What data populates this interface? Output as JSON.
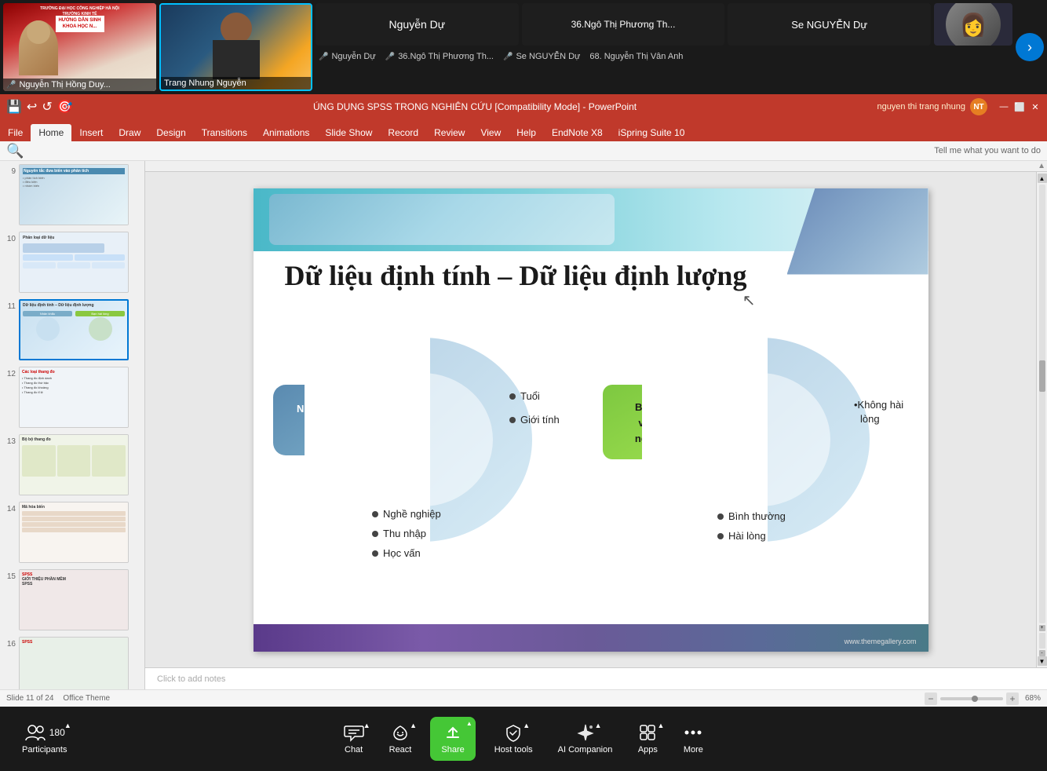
{
  "video_strip": {
    "tiles": [
      {
        "id": 1,
        "name": "Nguyễn Thị Hồng Duy...",
        "bg": "video-bg-1",
        "active": false,
        "mic_muted": true
      },
      {
        "id": 2,
        "name": "Trang Nhung Nguyễn",
        "bg": "video-bg-2",
        "active": true,
        "mic_muted": false
      },
      {
        "id": 3,
        "name": "Nguyễn Dự",
        "bg": "video-bg-3",
        "active": false,
        "mic_muted": true
      },
      {
        "id": 4,
        "name": "36.Ngô Thị Phương Th...",
        "bg": "video-bg-4",
        "active": false,
        "mic_muted": true
      },
      {
        "id": 5,
        "name": "Se NGUYỄN Dự",
        "bg": "video-bg-5",
        "active": false,
        "mic_muted": true
      },
      {
        "id": 6,
        "name": "68. Nguyễn Thị Vân Anh",
        "bg": "video-bg-5",
        "active": false,
        "mic_muted": false
      }
    ]
  },
  "participant_names": [
    {
      "name": "Nguyễn Dự",
      "mic_muted": true
    },
    {
      "name": "36.Ngô Thị Phương Th...",
      "mic_muted": true
    },
    {
      "name": "Se NGUYỄN Dự",
      "mic_muted": true
    },
    {
      "name": "68. Nguyễn Thị Vân Anh",
      "mic_muted": false
    }
  ],
  "ppt_window": {
    "title": "ÚNG DỤNG SPSS TRONG NGHIÊN CỨU [Compatibility Mode] - PowerPoint",
    "user": "nguyen thi trang nhung",
    "user_badge": "NT",
    "quick_tools": [
      "💾",
      "↩",
      "↺",
      "⬇"
    ]
  },
  "ribbon": {
    "tabs": [
      "File",
      "Home",
      "Insert",
      "Draw",
      "Design",
      "Transitions",
      "Animations",
      "Slide Show",
      "Record",
      "Review",
      "View",
      "Help",
      "EndNote X8",
      "iSpring Suite 10"
    ],
    "active_tab": "Home",
    "search_placeholder": "Tell me what you want to do"
  },
  "slide_panel": {
    "slides": [
      9,
      10,
      11,
      12,
      13,
      14,
      15,
      16
    ]
  },
  "current_slide": {
    "number": 11,
    "title": "Dữ liệu định tính – Dữ liệu định lượng",
    "left_diagram": {
      "center_label": "Nhân khẩu/\nkinh tế -\nxã hội",
      "right_labels": [
        "Tuổi",
        "Giới tính"
      ],
      "bottom_labels": [
        "Nghề nghiệp",
        "Thu nhập",
        "Học vấn"
      ]
    },
    "right_diagram": {
      "center_label": "Bạn hài lòng\nvới dịch vụ\nngân hàng A",
      "right_labels": [
        "Không hài\nlòng"
      ],
      "bottom_labels": [
        "Bình thường",
        "Hài lòng"
      ]
    },
    "website": "www.themegallery.com",
    "notes_placeholder": "Click to add notes"
  },
  "zoom_toolbar": {
    "participants_count": "180",
    "items": [
      {
        "label": "Participants",
        "icon": "👥",
        "has_chevron": true
      },
      {
        "label": "Chat",
        "icon": "💬",
        "has_chevron": true
      },
      {
        "label": "React",
        "icon": "♡",
        "has_chevron": true
      },
      {
        "label": "Share",
        "icon": "⬆",
        "has_chevron": true,
        "is_share": true
      },
      {
        "label": "Host tools",
        "icon": "🛡",
        "has_chevron": true
      },
      {
        "label": "AI Companion",
        "icon": "✦",
        "has_chevron": true
      },
      {
        "label": "Apps",
        "icon": "⚙",
        "has_chevron": true
      },
      {
        "label": "More",
        "icon": "•••",
        "has_chevron": true
      }
    ]
  },
  "status_bar": {
    "slide_info": "Slide 11 of 24",
    "theme": "Office Theme",
    "zoom_level": "68%"
  }
}
